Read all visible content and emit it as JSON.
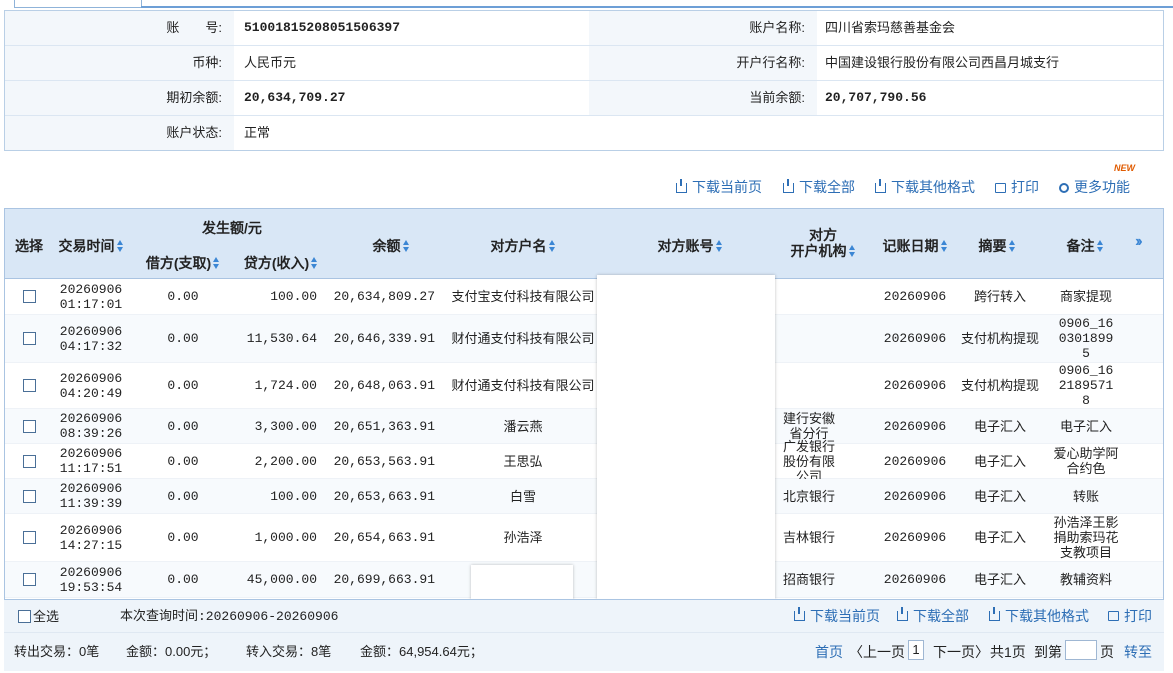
{
  "account": {
    "account_no_label": "账　　号:",
    "account_no": "51001815208051506397",
    "account_name_label": "账户名称:",
    "account_name": "四川省索玛慈善基金会",
    "currency_label": "币种:",
    "currency": "人民币元",
    "bank_label": "开户行名称:",
    "bank": "中国建设银行股份有限公司西昌月城支行",
    "opening_label": "期初余额:",
    "opening": "20,634,709.27",
    "current_label": "当前余额:",
    "current": "20,707,790.56",
    "status_label": "账户状态:",
    "status": "正常"
  },
  "toolbar": {
    "download_page": "下载当前页",
    "download_all": "下载全部",
    "download_other": "下载其他格式",
    "print": "打印",
    "more": "更多功能",
    "new_badge": "NEW"
  },
  "table": {
    "headers": {
      "select": "选择",
      "time": "交易时间",
      "amount_group": "发生额/元",
      "debit": "借方(支取)",
      "credit": "贷方(收入)",
      "balance": "余额",
      "party_name": "对方户名",
      "party_account": "对方账号",
      "party_bank_1": "对方",
      "party_bank_2": "开户机构",
      "post_date": "记账日期",
      "summary": "摘要",
      "remark": "备注",
      "more": "››"
    },
    "rows": [
      {
        "date": "20260906",
        "time": "01:17:01",
        "debit": "0.00",
        "credit": "100.00",
        "balance": "20,634,809.27",
        "party": "支付宝支付科技有限公司",
        "bank": "",
        "post": "20260906",
        "summary": "跨行转入",
        "remark": "商家提现"
      },
      {
        "date": "20260906",
        "time": "04:17:32",
        "debit": "0.00",
        "credit": "11,530.64",
        "balance": "20,646,339.91",
        "party": "财付通支付科技有限公司",
        "bank": "",
        "post": "20260906",
        "summary": "支付机构提现",
        "remark": "0906_1603018995"
      },
      {
        "date": "20260906",
        "time": "04:20:49",
        "debit": "0.00",
        "credit": "1,724.00",
        "balance": "20,648,063.91",
        "party": "财付通支付科技有限公司",
        "bank": "",
        "post": "20260906",
        "summary": "支付机构提现",
        "remark": "0906_1621895718"
      },
      {
        "date": "20260906",
        "time": "08:39:26",
        "debit": "0.00",
        "credit": "3,300.00",
        "balance": "20,651,363.91",
        "party": "潘云燕",
        "bank": "建行安徽省分行",
        "post": "20260906",
        "summary": "电子汇入",
        "remark": "电子汇入"
      },
      {
        "date": "20260906",
        "time": "11:17:51",
        "debit": "0.00",
        "credit": "2,200.00",
        "balance": "20,653,563.91",
        "party": "王思弘",
        "bank": "广发银行股份有限公司",
        "post": "20260906",
        "summary": "电子汇入",
        "remark": "爱心助学阿合约色"
      },
      {
        "date": "20260906",
        "time": "11:39:39",
        "debit": "0.00",
        "credit": "100.00",
        "balance": "20,653,663.91",
        "party": "白雪",
        "bank": "北京银行",
        "post": "20260906",
        "summary": "电子汇入",
        "remark": "转账"
      },
      {
        "date": "20260906",
        "time": "14:27:15",
        "debit": "0.00",
        "credit": "1,000.00",
        "balance": "20,654,663.91",
        "party": "孙浩泽",
        "bank": "吉林银行",
        "post": "20260906",
        "summary": "电子汇入",
        "remark": "孙浩泽王影捐助索玛花支教项目"
      },
      {
        "date": "20260906",
        "time": "19:53:54",
        "debit": "0.00",
        "credit": "45,000.00",
        "balance": "20,699,663.91",
        "party": "",
        "bank": "招商银行",
        "post": "20260906",
        "summary": "电子汇入",
        "remark": "教辅资料"
      }
    ]
  },
  "footer": {
    "select_all": "全选",
    "query_time": "本次查询时间:20260906-20260906",
    "download_page": "下载当前页",
    "download_all": "下载全部",
    "download_other": "下载其他格式",
    "print": "打印",
    "out_tx": "转出交易：0笔",
    "out_amount": "金额：0.00元；",
    "in_tx": "转入交易：8笔",
    "in_amount": "金额：64,954.64元；",
    "first": "首页",
    "prev": "〈上一页",
    "page": "1",
    "next": "下一页〉",
    "total": "共1页",
    "goto": "到第",
    "page_unit": "页",
    "go": "转至"
  }
}
